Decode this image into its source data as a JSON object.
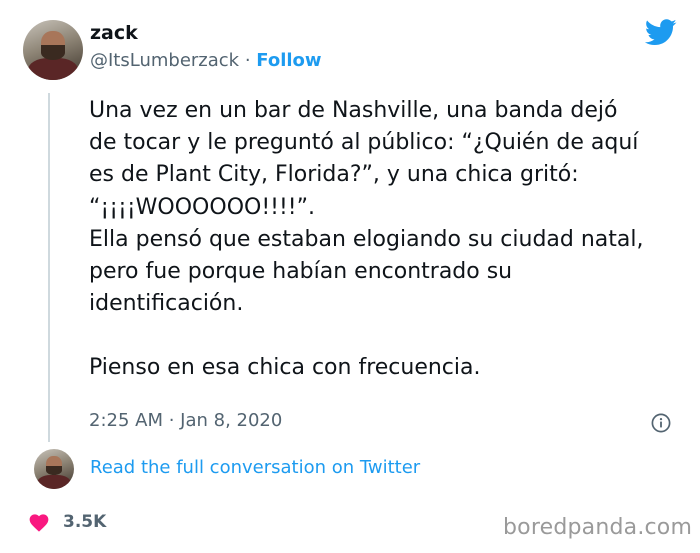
{
  "user": {
    "name": "zack",
    "handle": "@ItsLumberzack",
    "separator": " · ",
    "follow_label": "Follow"
  },
  "tweet": {
    "lines": [
      "Una vez en un bar de Nashville, una banda dejó",
      "de tocar y le preguntó al público: “¿Quién de aquí",
      "es de Plant City, Florida?”, y una chica gritó:",
      "“¡¡¡¡WOOOOOO!!!!”.",
      "Ella pensó que estaban elogiando su ciudad natal,",
      "pero fue porque habían encontrado su",
      "identificación."
    ],
    "last_line": "Pienso en esa chica con frecuencia.",
    "timestamp": "2:25 AM · Jan 8, 2020"
  },
  "conversation": {
    "link_label": "Read the full conversation on Twitter"
  },
  "likes": {
    "count": "3.5K"
  },
  "watermark": "boredpanda.com",
  "icons": [
    "twitter-bird-icon",
    "info-icon",
    "heart-icon"
  ],
  "colors": {
    "accent": "#1d9bf0",
    "text": "#0f1419",
    "muted": "#536471",
    "heart": "#f91880",
    "watermark": "#9a9a9a"
  }
}
